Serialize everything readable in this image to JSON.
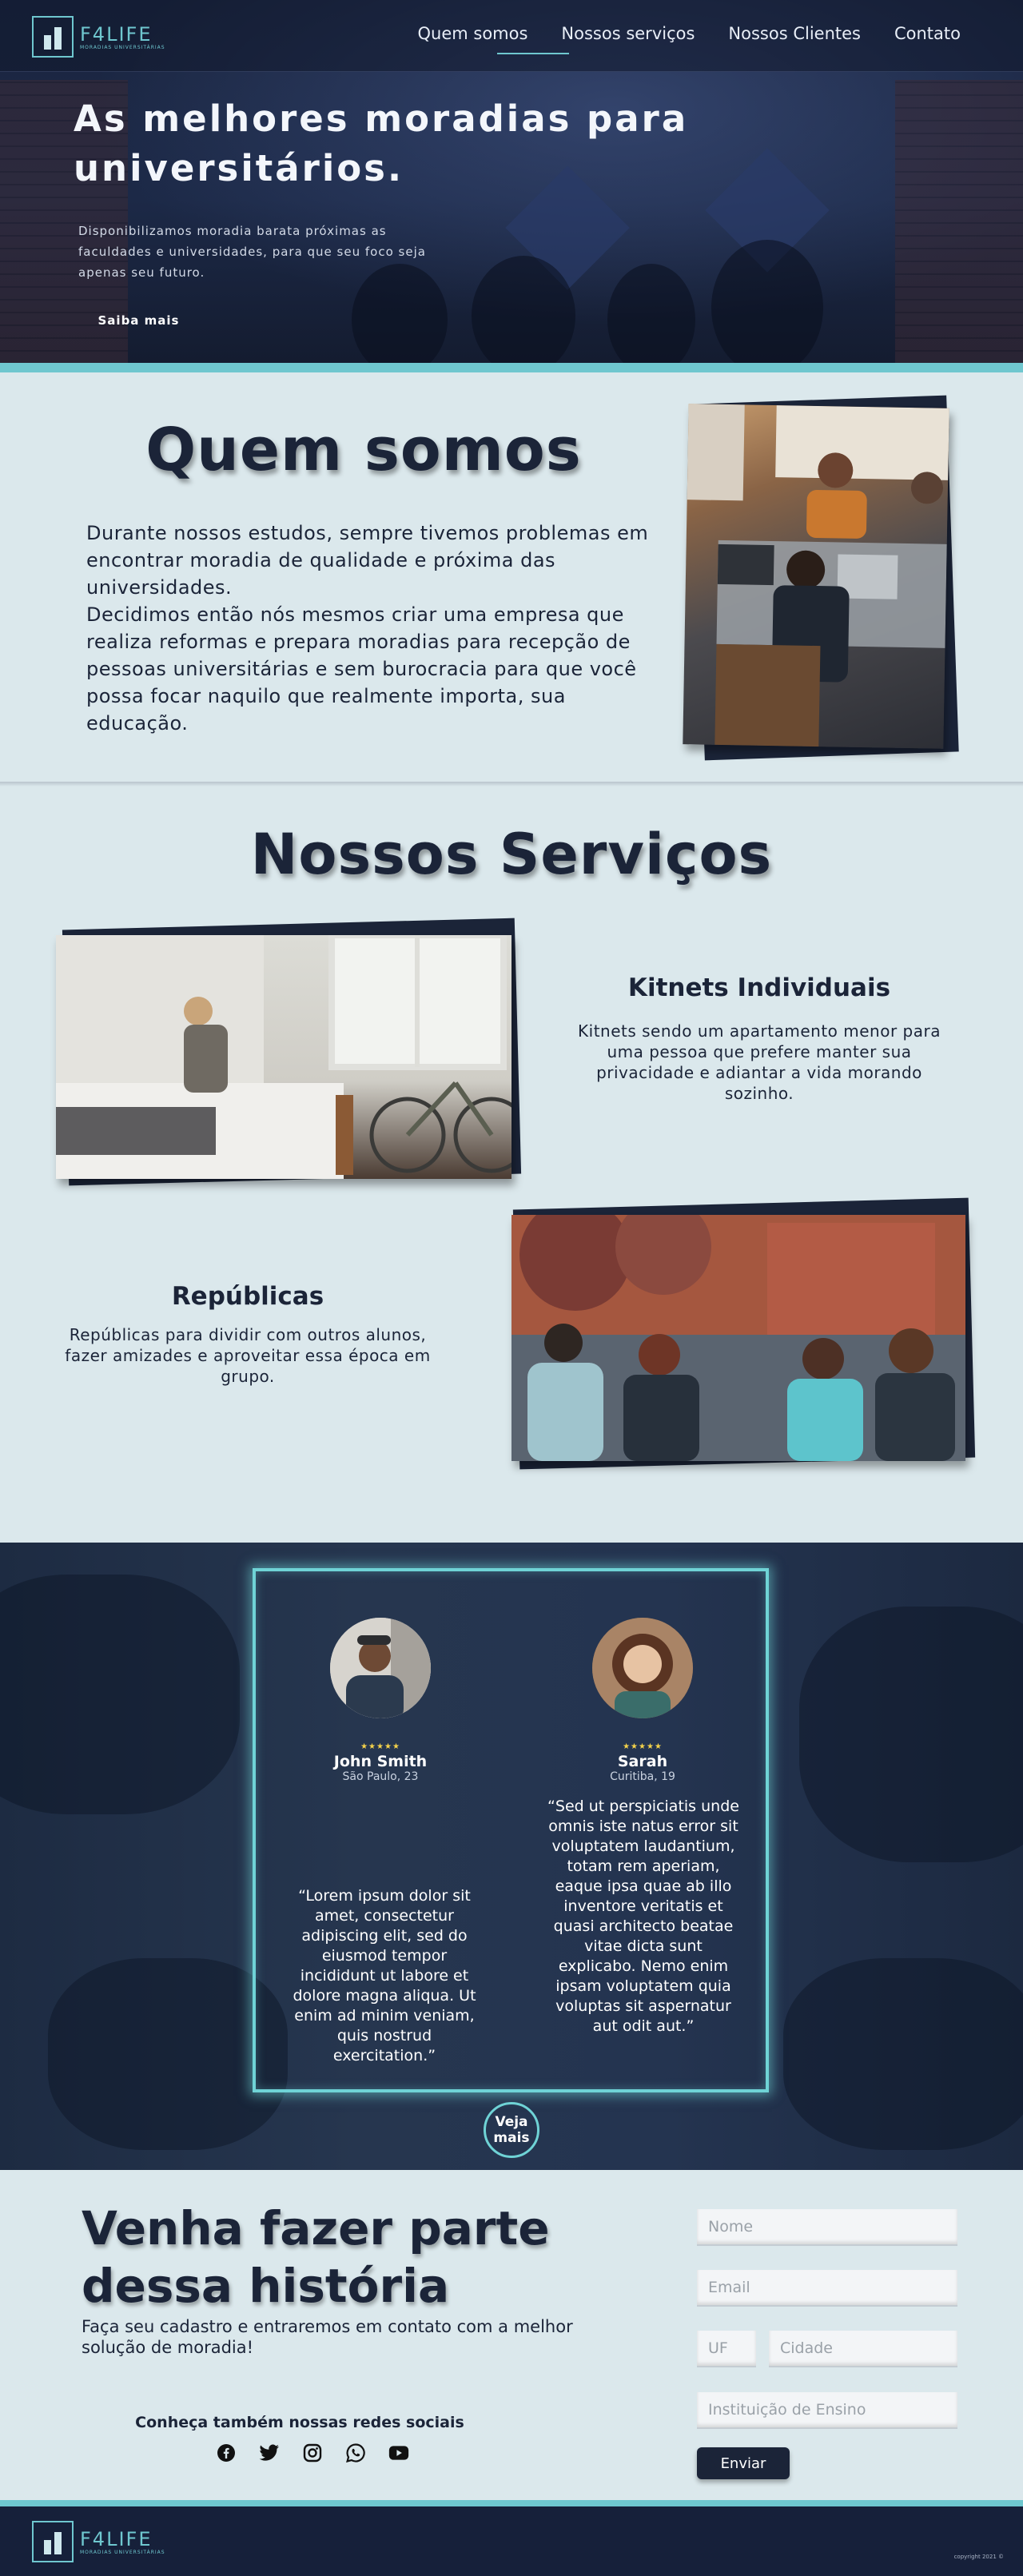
{
  "brand": {
    "name": "F4LIFE",
    "tagline": "MORADIAS UNIVERSITÁRIAS",
    "accent": "#6fc7cf",
    "dark": "#1b2438"
  },
  "nav": {
    "items": [
      "Quem somos",
      "Nossos serviços",
      "Nossos Clientes",
      "Contato"
    ]
  },
  "hero": {
    "title": "As melhores moradias para universitários.",
    "description": "Disponibilizamos moradia barata próximas as faculdades e universidades, para que seu foco seja apenas seu futuro.",
    "button": "Saiba mais"
  },
  "about": {
    "title": "Quem somos",
    "text": "Durante nossos estudos, sempre tivemos problemas em encontrar moradia de qualidade e próxima das universidades.\nDecidimos então nós mesmos criar uma empresa que realiza reformas e prepara moradias para recepção de pessoas universitárias e sem burocracia para que você possa focar naquilo que realmente importa, sua educação."
  },
  "services": {
    "title": "Nossos Serviços",
    "items": [
      {
        "title": "Kitnets Individuais",
        "description": "Kitnets sendo um apartamento menor para uma pessoa que prefere manter sua privacidade e adiantar a vida morando sozinho."
      },
      {
        "title": "Repúblicas",
        "description": "Repúblicas para dividir com outros alunos, fazer amizades e aproveitar essa época em grupo."
      }
    ]
  },
  "testimonials": {
    "items": [
      {
        "stars": "★★★★★",
        "name": "John Smith",
        "location": "São Paulo, 23",
        "quote": "“Lorem ipsum dolor sit amet, consectetur adipiscing elit, sed do eiusmod tempor incididunt ut labore et dolore magna aliqua. Ut enim ad minim veniam, quis nostrud exercitation.”"
      },
      {
        "stars": "★★★★★",
        "name": "Sarah",
        "location": "Curitiba, 19",
        "quote": "“Sed ut perspiciatis unde omnis iste natus error sit voluptatem laudantium, totam rem aperiam, eaque ipsa quae ab illo inventore veritatis et quasi architecto beatae vitae dicta sunt explicabo. Nemo enim ipsam voluptatem quia voluptas sit aspernatur aut odit aut.”"
      }
    ],
    "more_button": "Veja mais"
  },
  "cta": {
    "title": "Venha fazer parte dessa história",
    "subtitle": "Faça seu cadastro e entraremos em contato com a melhor solução de moradia!",
    "social_title": "Conheça também nossas redes sociais",
    "socials": [
      "facebook-icon",
      "twitter-icon",
      "instagram-icon",
      "whatsapp-icon",
      "youtube-icon"
    ]
  },
  "form": {
    "name_placeholder": "Nome",
    "email_placeholder": "Email",
    "uf_placeholder": "UF",
    "city_placeholder": "Cidade",
    "institution_placeholder": "Instituição de Ensino",
    "submit": "Enviar"
  },
  "footer": {
    "copyright": "copyright 2021 ©"
  }
}
